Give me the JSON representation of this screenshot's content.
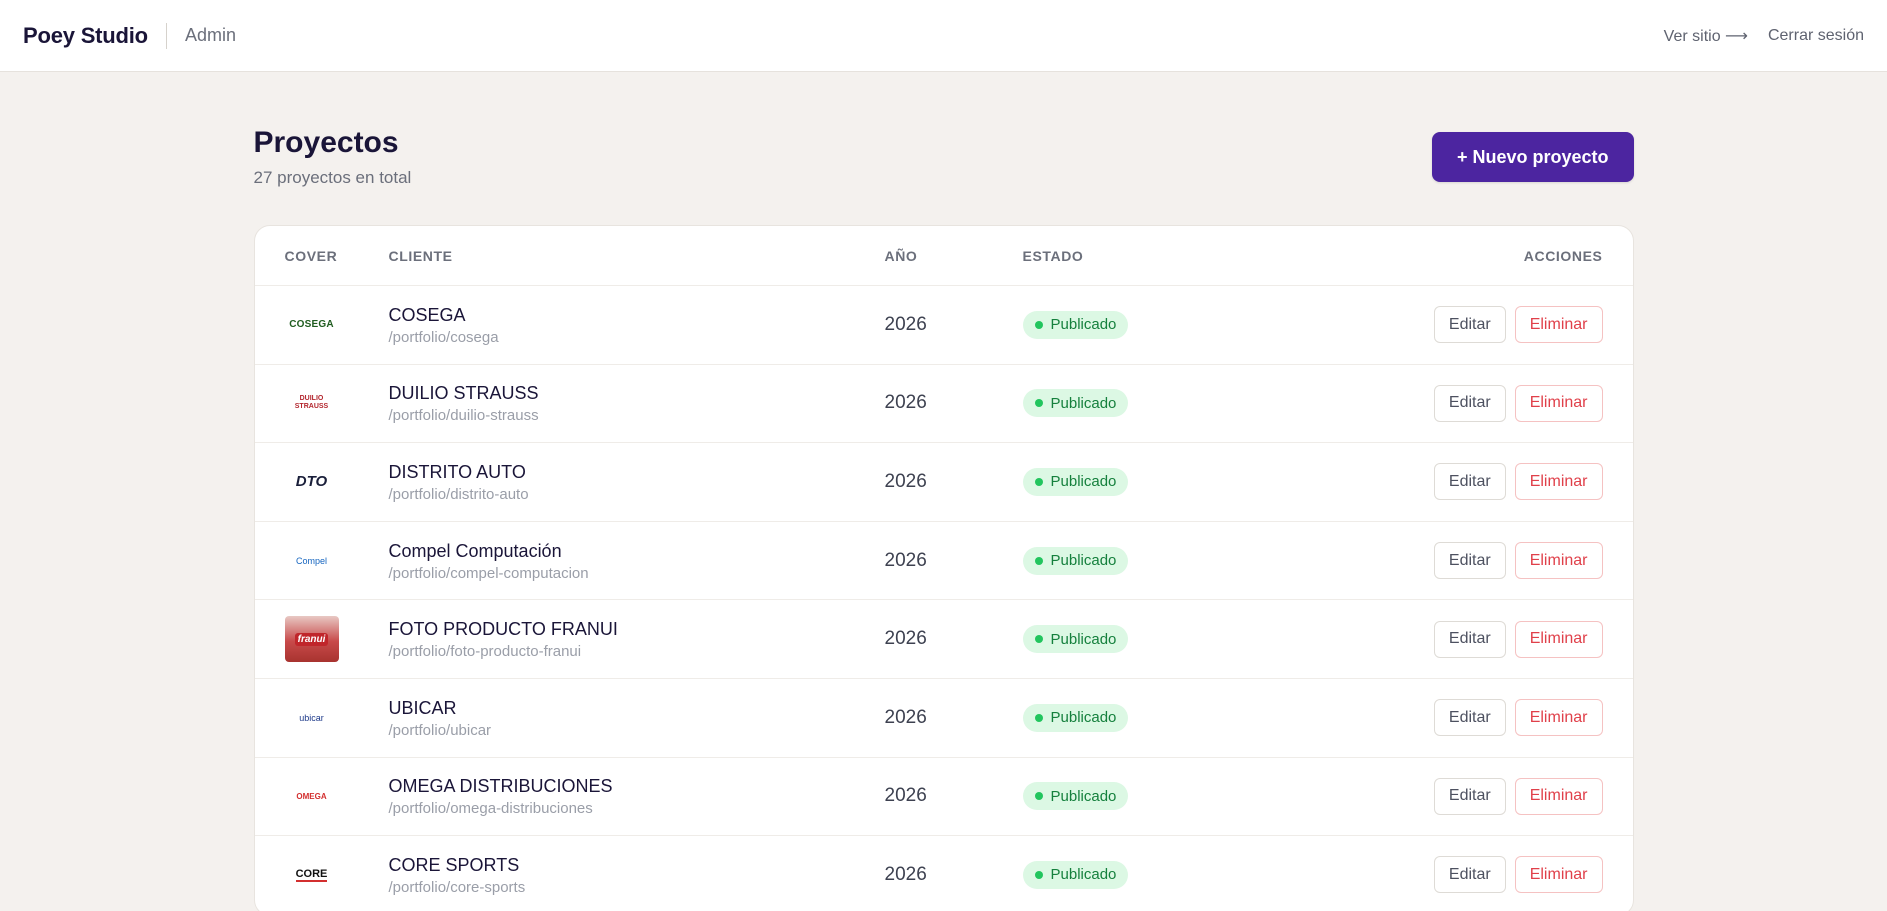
{
  "header": {
    "brand": "Poey Studio",
    "section": "Admin",
    "view_site": "Ver sitio ⟶",
    "logout": "Cerrar sesión"
  },
  "page": {
    "title": "Proyectos",
    "count": "27 proyectos en total",
    "new_button": "+ Nuevo proyecto"
  },
  "table": {
    "columns": {
      "cover": "COVER",
      "client": "CLIENTE",
      "year": "AÑO",
      "status": "ESTADO",
      "actions": "ACCIONES"
    },
    "edit_label": "Editar",
    "delete_label": "Eliminar",
    "rows": [
      {
        "client": "COSEGA",
        "slug": "/portfolio/cosega",
        "year": "2026",
        "status": "Publicado",
        "cover_logo": "COSEGA"
      },
      {
        "client": "DUILIO STRAUSS",
        "slug": "/portfolio/duilio-strauss",
        "year": "2026",
        "status": "Publicado",
        "cover_logo": "DUILIO STRAUSS"
      },
      {
        "client": "DISTRITO AUTO",
        "slug": "/portfolio/distrito-auto",
        "year": "2026",
        "status": "Publicado",
        "cover_logo": "DTO"
      },
      {
        "client": "Compel Computación",
        "slug": "/portfolio/compel-computacion",
        "year": "2026",
        "status": "Publicado",
        "cover_logo": "Compel"
      },
      {
        "client": "FOTO PRODUCTO FRANUI",
        "slug": "/portfolio/foto-producto-franui",
        "year": "2026",
        "status": "Publicado",
        "cover_logo": "franui"
      },
      {
        "client": "UBICAR",
        "slug": "/portfolio/ubicar",
        "year": "2026",
        "status": "Publicado",
        "cover_logo": "ubicar"
      },
      {
        "client": "OMEGA DISTRIBUCIONES",
        "slug": "/portfolio/omega-distribuciones",
        "year": "2026",
        "status": "Publicado",
        "cover_logo": "OMEGA"
      },
      {
        "client": "CORE SPORTS",
        "slug": "/portfolio/core-sports",
        "year": "2026",
        "status": "Publicado",
        "cover_logo": "CORE"
      }
    ]
  },
  "colors": {
    "primary": "#4c25a0",
    "published_bg": "#dcf8e4",
    "published_text": "#15803d",
    "delete": "#e0404a"
  }
}
